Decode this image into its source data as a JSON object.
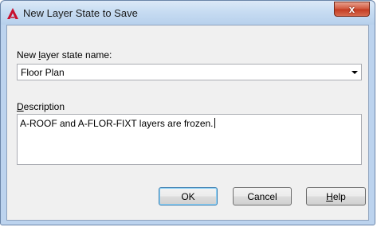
{
  "window": {
    "title": "New Layer State to Save",
    "close_label": "x"
  },
  "form": {
    "name_label_pre": "New ",
    "name_label_mnemonic": "l",
    "name_label_post": "ayer state name:",
    "name_value": "Floor Plan",
    "description_label_mnemonic": "D",
    "description_label_post": "escription",
    "description_value": "A-ROOF and A-FLOR-FIXT layers are frozen."
  },
  "buttons": {
    "ok": "OK",
    "cancel": "Cancel",
    "help_mnemonic": "H",
    "help_post": "elp"
  },
  "icons": {
    "app": "autocad-logo-icon",
    "close": "close-icon",
    "dropdown": "chevron-down-icon"
  },
  "colors": {
    "accent_red": "#c8102e",
    "close_red": "#c33a20",
    "focus_blue": "#3c7fb1"
  }
}
